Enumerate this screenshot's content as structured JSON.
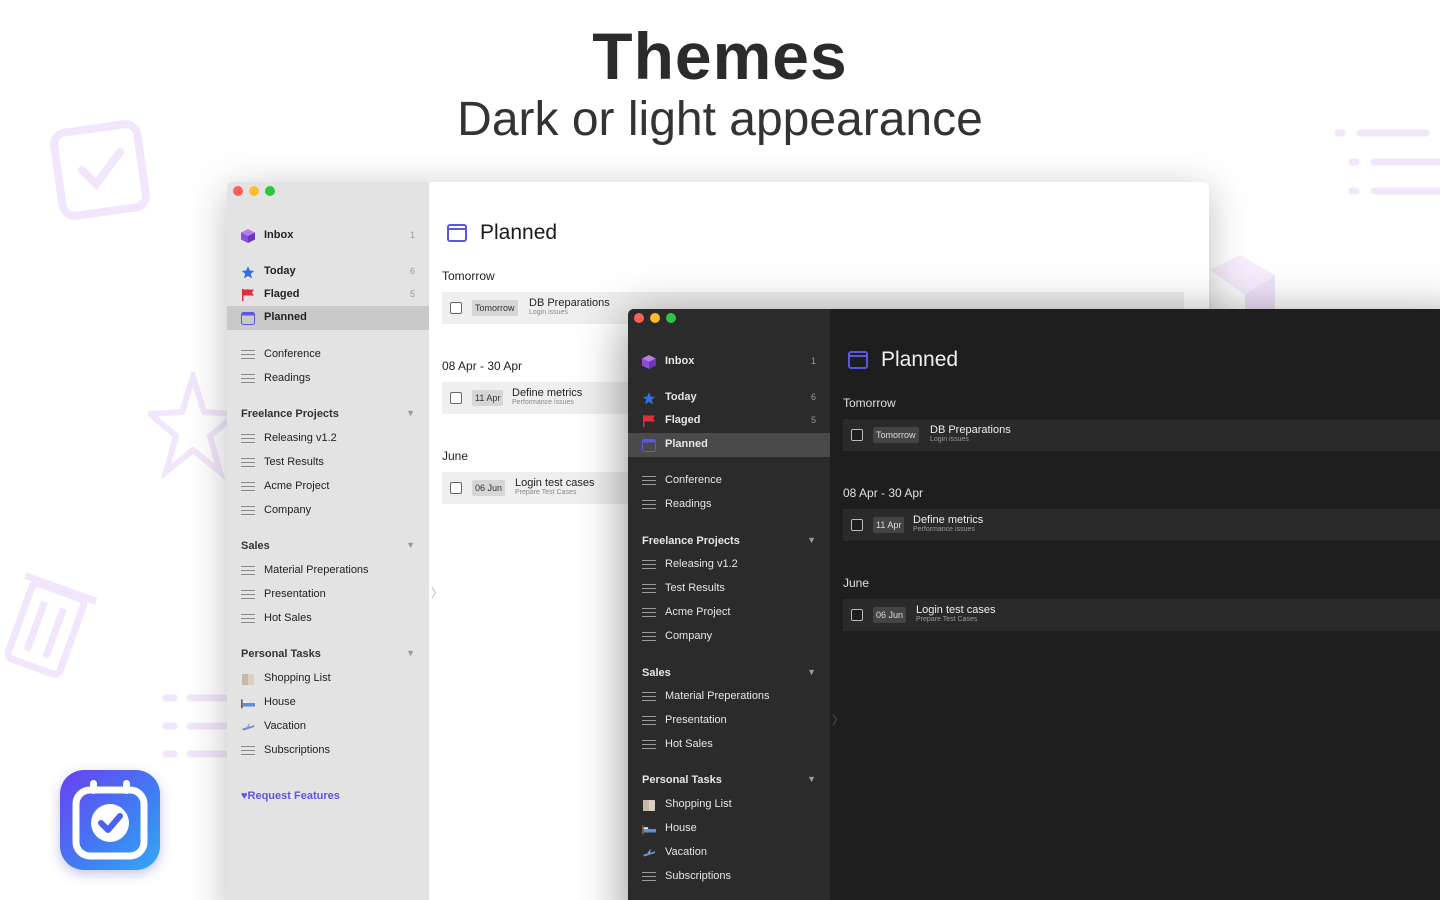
{
  "hero": {
    "title": "Themes",
    "subtitle": "Dark or light appearance"
  },
  "colors": {
    "accent": "#5b57e8",
    "light_sidebar": "#e3e3e3",
    "dark_sidebar": "#2b2b2b",
    "dark_main": "#1e1e1e"
  },
  "sidebar": {
    "inbox": {
      "label": "Inbox",
      "count": "1"
    },
    "today": {
      "label": "Today",
      "count": "6"
    },
    "flagged": {
      "label": "Flaged",
      "count": "5"
    },
    "planned": {
      "label": "Planned"
    },
    "lists": [
      "Conference",
      "Readings"
    ],
    "groups": [
      {
        "name": "Freelance Projects",
        "items": [
          "Releasing v1.2",
          "Test Results",
          "Acme Project",
          "Company"
        ]
      },
      {
        "name": "Sales",
        "items": [
          "Material Preperations",
          "Presentation",
          "Hot Sales"
        ]
      },
      {
        "name": "Personal Tasks",
        "items": [
          "Shopping List",
          "House",
          "Vacation",
          "Subscriptions"
        ]
      }
    ],
    "request_features": "Request Features"
  },
  "main": {
    "title": "Planned",
    "sections": [
      {
        "heading": "Tomorrow",
        "task": {
          "date": "Tomorrow",
          "title": "DB Preparations",
          "note": "Login issues"
        }
      },
      {
        "heading": "08 Apr - 30 Apr",
        "task": {
          "date": "11 Apr",
          "title": "Define metrics",
          "note": "Performance issues"
        }
      },
      {
        "heading": "June",
        "task": {
          "date": "06 Jun",
          "title": "Login test cases",
          "note": "Prepare Test Cases"
        }
      }
    ]
  }
}
